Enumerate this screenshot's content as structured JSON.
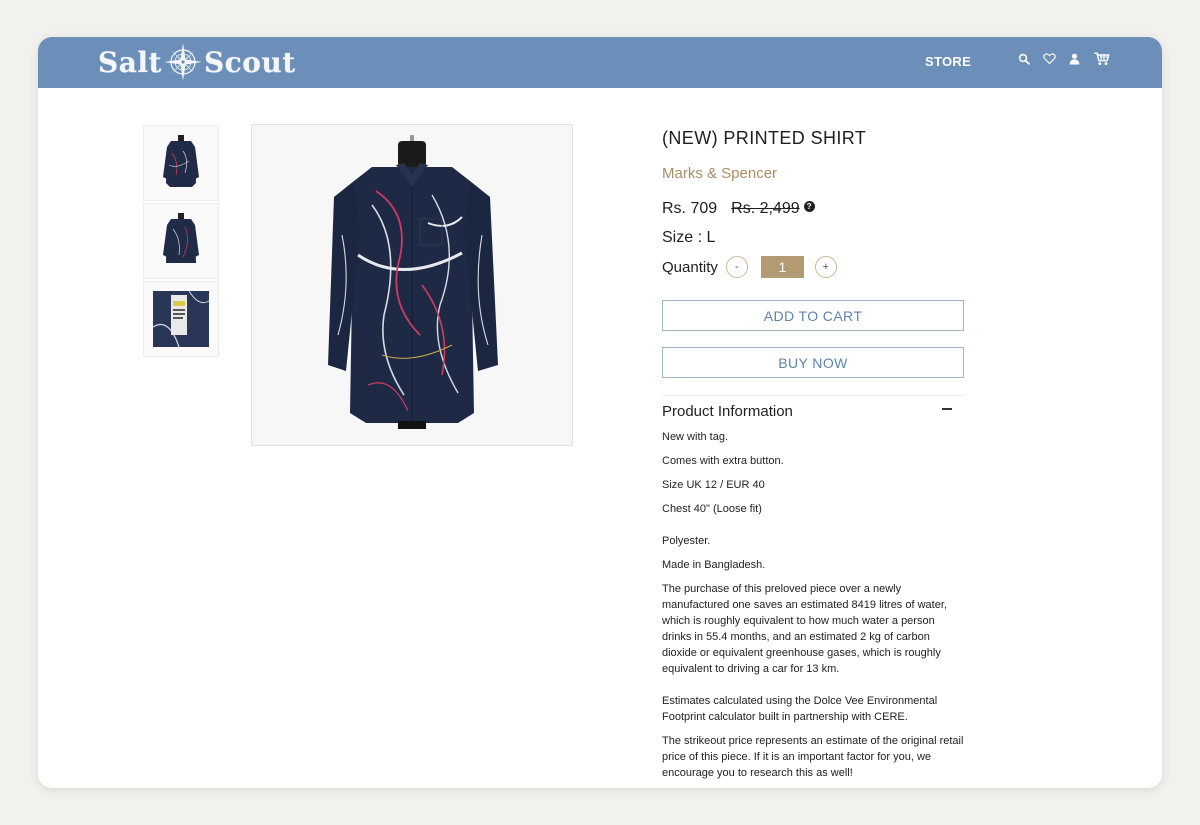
{
  "header": {
    "logo_left": "Salt",
    "logo_right": "Scout",
    "nav_store": "STORE",
    "icons": [
      "search-icon",
      "heart-icon",
      "user-icon",
      "cart-icon"
    ],
    "bar_color": "#6b8fb8"
  },
  "gallery": {
    "thumbnails": [
      "shirt-front-thumbnail",
      "shirt-back-thumbnail",
      "label-tag-thumbnail"
    ],
    "main_image": "printed-shirt-front-photo"
  },
  "product": {
    "title": "(NEW) PRINTED SHIRT",
    "brand": "Marks & Spencer",
    "price": "Rs. 709",
    "original_price": "Rs. 2,499",
    "size": "Size : L",
    "quantity_label": "Quantity",
    "quantity_minus": "-",
    "quantity_value": "1",
    "quantity_plus": "+",
    "add_to_cart": "ADD TO CART",
    "buy_now": "BUY NOW",
    "accent_color": "#b39a72",
    "button_text_color": "#5e83ad"
  },
  "info": {
    "title": "Product Information",
    "lines": [
      "New with tag.",
      "Comes with extra button.",
      "Size UK 12 / EUR 40",
      "Chest 40\" (Loose fit)",
      "Polyester.",
      "Made in Bangladesh.",
      "The purchase of this preloved piece over a newly manufactured one saves an estimated 8419 litres of water, which is roughly equivalent to how much water a person drinks in 55.4 months, and an estimated 2 kg of carbon dioxide or equivalent greenhouse gases, which is roughly equivalent to driving a car for 13 km.",
      "Estimates calculated using the Dolce Vee Environmental Footprint calculator built in partnership with CERE.",
      "The strikeout price represents an estimate of the original retail price of this piece. If it is an important factor for you, we encourage you to research this as well!"
    ]
  }
}
